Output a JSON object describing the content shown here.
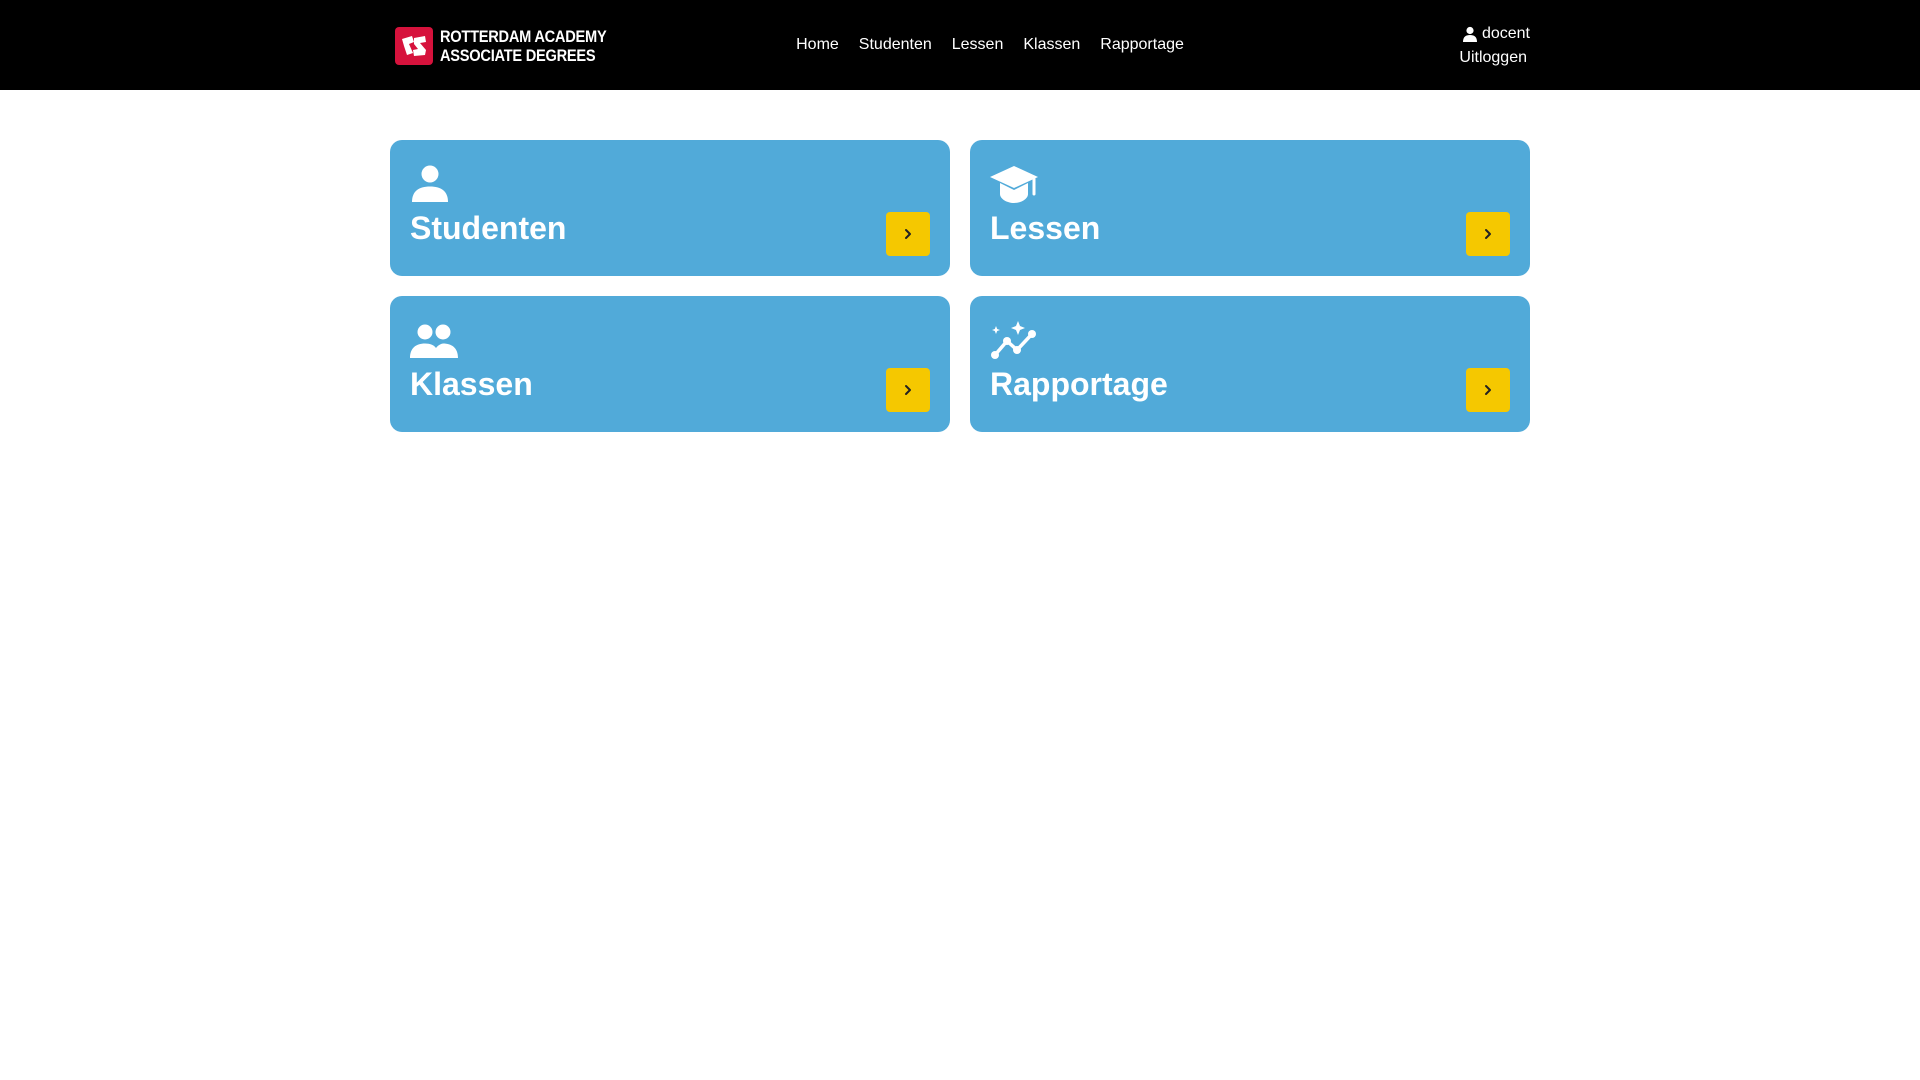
{
  "header": {
    "logo": {
      "line1": "ROTTERDAM ACADEMY",
      "line2": "ASSOCIATE DEGREES",
      "brand_color": "#d6123c"
    },
    "nav": [
      {
        "label": "Home"
      },
      {
        "label": "Studenten"
      },
      {
        "label": "Lessen"
      },
      {
        "label": "Klassen"
      },
      {
        "label": "Rapportage"
      }
    ],
    "user": {
      "icon": "person-icon",
      "name": "docent",
      "logout_label": "Uitloggen"
    }
  },
  "cards": [
    {
      "title": "Studenten",
      "icon": "person-icon",
      "button_icon": "chevron-right-icon"
    },
    {
      "title": "Lessen",
      "icon": "graduation-cap-icon",
      "button_icon": "chevron-right-icon"
    },
    {
      "title": "Klassen",
      "icon": "group-icon",
      "button_icon": "chevron-right-icon"
    },
    {
      "title": "Rapportage",
      "icon": "analytics-sparkle-icon",
      "button_icon": "chevron-right-icon"
    }
  ],
  "colors": {
    "header_bg": "#000000",
    "card_bg": "#51aad9",
    "button_bg": "#f5c800",
    "text_light": "#ffffff"
  }
}
